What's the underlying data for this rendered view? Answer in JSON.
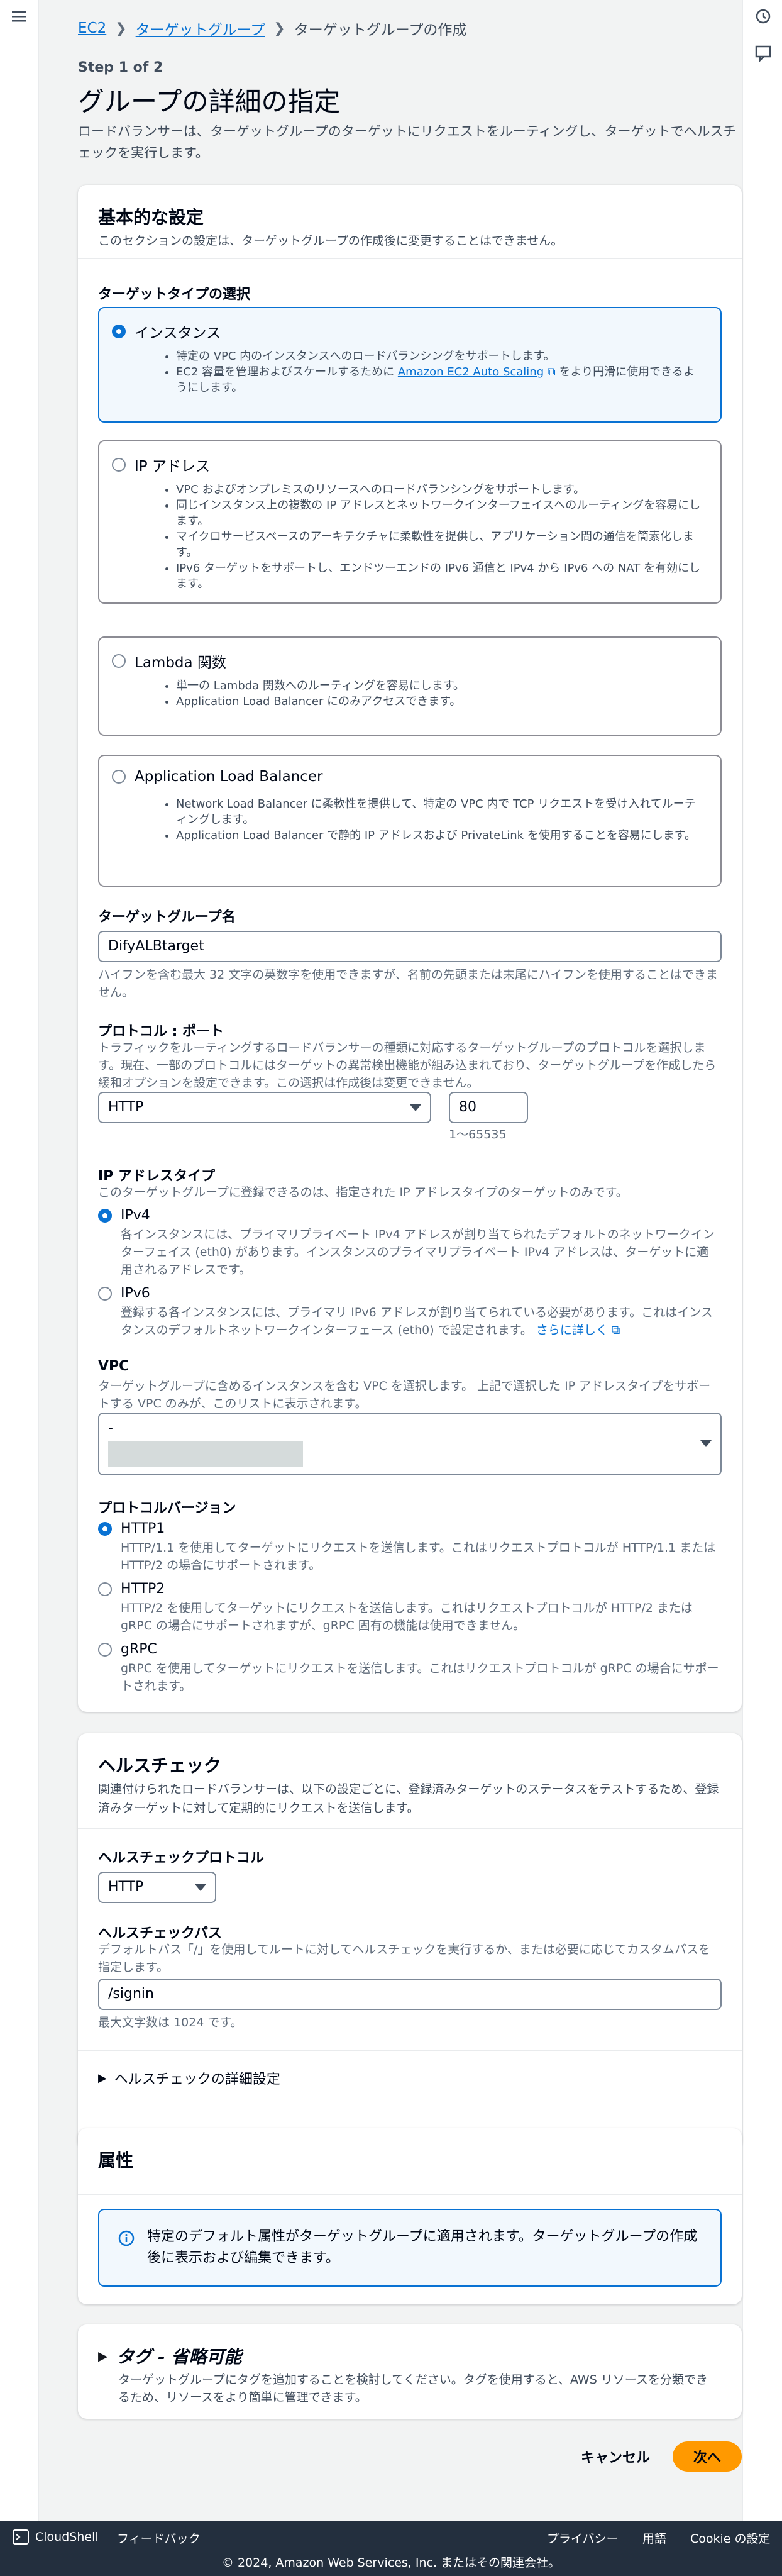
{
  "breadcrumb": [
    "EC2",
    "ターゲットグループ",
    "ターゲットグループの作成"
  ],
  "step": "Step 1 of 2",
  "page_title": "グループの詳細の指定",
  "page_desc": "ロードバランサーは、ターゲットグループのターゲットにリクエストをルーティングし、ターゲットでヘルスチェックを実行します。",
  "basic": {
    "title": "基本的な設定",
    "desc": "このセクションの設定は、ターゲットグループの作成後に変更することはできません。",
    "target_type_label": "ターゲットタイプの選択",
    "tiles": [
      {
        "title": "インスタンス",
        "selected": true,
        "bullets": [
          "特定の VPC 内のインスタンスへのロードバランシングをサポートします。",
          "EC2 容量を管理およびスケールするために ",
          "Amazon EC2 Auto Scaling",
          " をより円滑に使用できるようにします。"
        ]
      },
      {
        "title": "IP アドレス",
        "selected": false,
        "bullets": [
          "VPC およびオンプレミスのリソースへのロードバランシングをサポートします。",
          "同じインスタンス上の複数の IP アドレスとネットワークインターフェイスへのルーティングを容易にします。",
          "マイクロサービスベースのアーキテクチャに柔軟性を提供し、アプリケーション間の通信を簡素化します。",
          "IPv6 ターゲットをサポートし、エンドツーエンドの IPv6 通信と IPv4 から IPv6 への NAT を有効にします。"
        ]
      },
      {
        "title": "Lambda 関数",
        "selected": false,
        "bullets": [
          "単一の Lambda 関数へのルーティングを容易にします。",
          "Application Load Balancer にのみアクセスできます。"
        ]
      },
      {
        "title": "Application Load Balancer",
        "selected": false,
        "bullets": [
          "Network Load Balancer に柔軟性を提供して、特定の VPC 内で TCP リクエストを受け入れてルーティングします。",
          "Application Load Balancer で静的 IP アドレスおよび PrivateLink を使用することを容易にします。"
        ]
      }
    ],
    "tg_name_label": "ターゲットグループ名",
    "tg_name_value": "DifyALBtarget",
    "tg_name_hint": "ハイフンを含む最大 32 文字の英数字を使用できますが、名前の先頭または末尾にハイフンを使用することはできません。",
    "protocol_port_label": "プロトコル : ポート",
    "protocol_port_desc": "トラフィックをルーティングするロードバランサーの種類に対応するターゲットグループのプロトコルを選択します。現在、一部のプロトコルにはターゲットの異常検出機能が組み込まれており、ターゲットグループを作成したら緩和オプションを設定できます。この選択は作成後は変更できません。",
    "protocol_value": "HTTP",
    "port_value": "80",
    "port_hint": "1〜65535",
    "ip_type_label": "IP アドレスタイプ",
    "ip_type_desc": "このターゲットグループに登録できるのは、指定された IP アドレスタイプのターゲットのみです。",
    "ip_options": [
      {
        "title": "IPv4",
        "selected": true,
        "desc": "各インスタンスには、プライマリプライベート IPv4 アドレスが割り当てられたデフォルトのネットワークインターフェイス (eth0) があります。インスタンスのプライマリプライベート IPv4 アドレスは、ターゲットに適用されるアドレスです。"
      },
      {
        "title": "IPv6",
        "selected": false,
        "desc": "登録する各インスタンスには、プライマリ IPv6 アドレスが割り当てられている必要があります。これはインスタンスのデフォルトネットワークインターフェース (eth0) で設定されます。",
        "link": "さらに詳しく"
      }
    ],
    "vpc_label": "VPC",
    "vpc_desc": "ターゲットグループに含めるインスタンスを含む VPC を選択します。 上記で選択した IP アドレスタイプをサポートする VPC のみが、このリストに表示されます。",
    "vpc_value": "-",
    "protocol_version_label": "プロトコルバージョン",
    "version_options": [
      {
        "title": "HTTP1",
        "selected": true,
        "desc": "HTTP/1.1 を使用してターゲットにリクエストを送信します。これはリクエストプロトコルが HTTP/1.1 または HTTP/2 の場合にサポートされます。"
      },
      {
        "title": "HTTP2",
        "selected": false,
        "desc": "HTTP/2 を使用してターゲットにリクエストを送信します。これはリクエストプロトコルが HTTP/2 または gRPC の場合にサポートされますが、gRPC 固有の機能は使用できません。"
      },
      {
        "title": "gRPC",
        "selected": false,
        "desc": "gRPC を使用してターゲットにリクエストを送信します。これはリクエストプロトコルが gRPC の場合にサポートされます。"
      }
    ]
  },
  "health": {
    "title": "ヘルスチェック",
    "desc": "関連付けられたロードバランサーは、以下の設定ごとに、登録済みターゲットのステータスをテストするため、登録済みターゲットに対して定期的にリクエストを送信します。",
    "protocol_label": "ヘルスチェックプロトコル",
    "protocol_value": "HTTP",
    "path_label": "ヘルスチェックパス",
    "path_desc": "デフォルトパス「/」を使用してルートに対してヘルスチェックを実行するか、または必要に応じてカスタムパスを指定します。",
    "path_value": "/signin",
    "path_hint": "最大文字数は 1024 です。",
    "advanced": "ヘルスチェックの詳細設定"
  },
  "attributes": {
    "title": "属性",
    "info": "特定のデフォルト属性がターゲットグループに適用されます。ターゲットグループの作成後に表示および編集できます。"
  },
  "tags": {
    "title": "タグ - 省略可能",
    "desc": "ターゲットグループにタグを追加することを検討してください。タグを使用すると、AWS リソースを分類できるため、リソースをより簡単に管理できます。"
  },
  "actions": {
    "cancel": "キャンセル",
    "next": "次へ"
  },
  "footer": {
    "cloudshell": "CloudShell",
    "feedback": "フィードバック",
    "privacy": "プライバシー",
    "terms": "用語",
    "cookie": "Cookie の設定",
    "copyright": "© 2024, Amazon Web Services, Inc. またはその関連会社。"
  },
  "colors": {
    "accent": "#0972d3",
    "primary_button": "#ff9900",
    "footer_bg": "#232f3e"
  }
}
